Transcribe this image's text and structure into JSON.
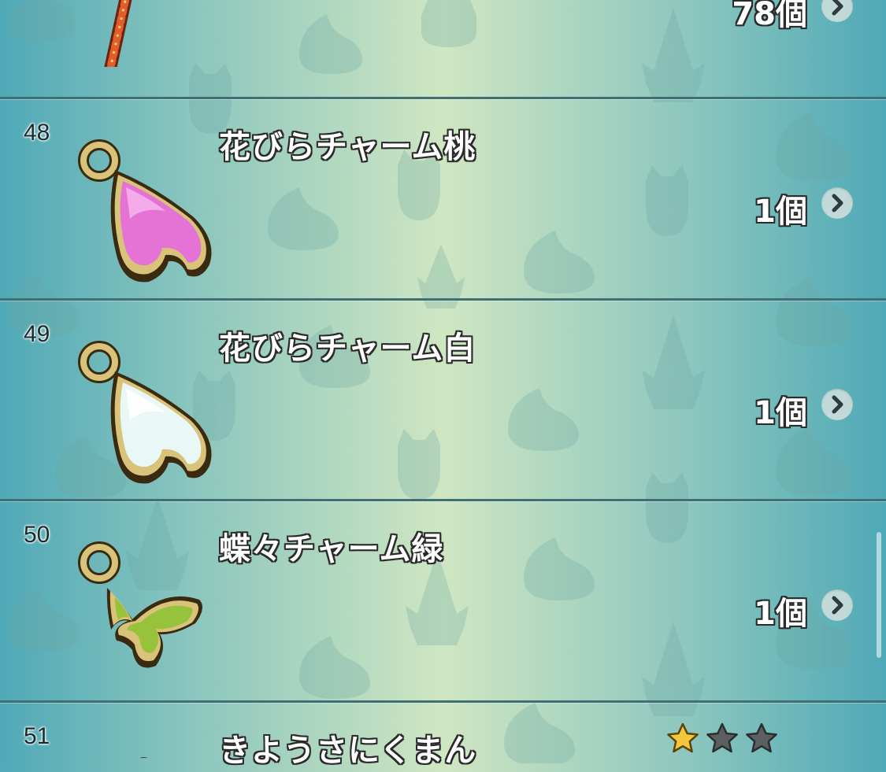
{
  "items": [
    {
      "no": "",
      "name": "",
      "qty": "78個",
      "icon": "staff-icon"
    },
    {
      "no": "48",
      "name": "花びらチャーム桃",
      "qty": "1個",
      "icon": "pink-petal-charm-icon",
      "color": "#e573d6"
    },
    {
      "no": "49",
      "name": "花びらチャーム白",
      "qty": "1個",
      "icon": "white-petal-charm-icon",
      "color": "#e9f7f6"
    },
    {
      "no": "50",
      "name": "蝶々チャーム緑",
      "qty": "1個",
      "icon": "green-butterfly-charm-icon",
      "color": "#97c23b"
    },
    {
      "no": "51",
      "name": "きようさにくまん",
      "qty": "",
      "icon": "nikuman-icon",
      "rarity": {
        "filled": 1,
        "total": 3
      }
    }
  ],
  "colors": {
    "star_filled": "#f4c63a",
    "star_empty": "#5b5f60",
    "divider": "#3f6e74",
    "gold_frame": "#d9c27a"
  }
}
